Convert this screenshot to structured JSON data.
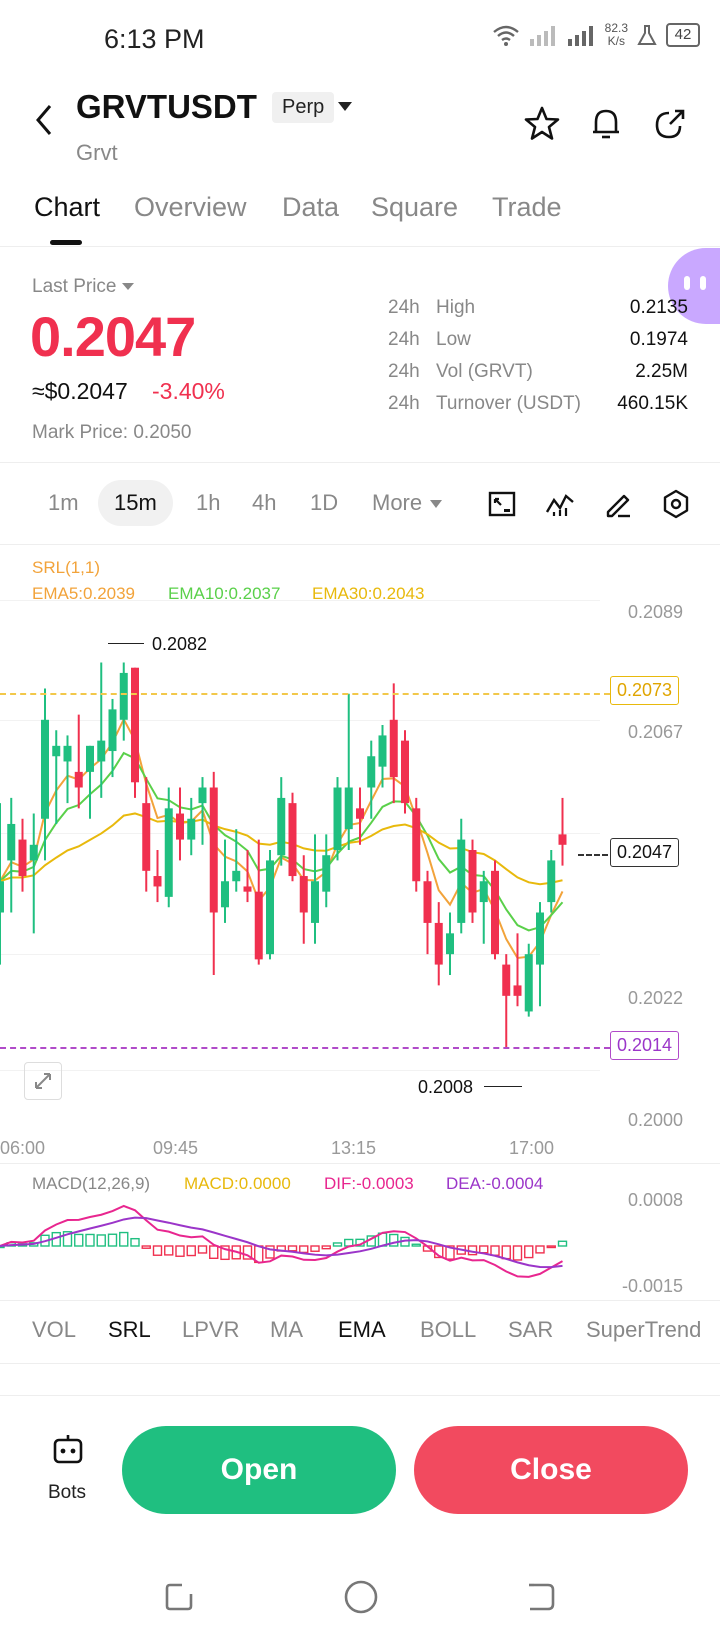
{
  "status": {
    "time": "6:13 PM",
    "net_speed_top": "82.3",
    "net_speed_bottom": "K/s",
    "battery": "42"
  },
  "header": {
    "symbol": "GRVTUSDT",
    "badge": "Perp",
    "name": "Grvt"
  },
  "tabs": [
    "Chart",
    "Overview",
    "Data",
    "Square",
    "Trade"
  ],
  "price": {
    "label": "Last Price",
    "last": "0.2047",
    "usd": "≈$0.2047",
    "change": "-3.40%",
    "mark": "Mark Price: 0.2050",
    "colors": {
      "down": "#f0304f",
      "up": "#1fbf80"
    }
  },
  "stats": [
    {
      "period": "24h",
      "label": "High",
      "value": "0.2135"
    },
    {
      "period": "24h",
      "label": "Low",
      "value": "0.1974"
    },
    {
      "period": "24h",
      "label": "Vol (GRVT)",
      "value": "2.25M"
    },
    {
      "period": "24h",
      "label": "Turnover (USDT)",
      "value": "460.15K"
    }
  ],
  "intervals": {
    "items": [
      "1m",
      "15m",
      "1h",
      "4h",
      "1D"
    ],
    "more": "More",
    "active": "15m"
  },
  "chart": {
    "srl": "SRL(1,1)",
    "ema5": "EMA5:0.2039",
    "ema10": "EMA10:0.2037",
    "ema30": "EMA30:0.2043",
    "y_labels": [
      "0.2089",
      "0.2067",
      "0.2022",
      "0.2000"
    ],
    "tag_top": "0.2073",
    "tag_current": "0.2047",
    "tag_bottom": "0.2014",
    "hi_label": "0.2082",
    "lo_label": "0.2008",
    "x_labels": [
      "06:00",
      "09:45",
      "13:15",
      "17:00"
    ],
    "macd_title": "MACD(12,26,9)",
    "macd_val": "MACD:0.0000",
    "dif": "DIF:-0.0003",
    "dea": "DEA:-0.0004",
    "macd_top": "0.0008",
    "macd_bottom": "-0.0015",
    "colors": {
      "ema5": "#f2a33a",
      "ema10": "#5ad04a",
      "ema30": "#e8b90c",
      "dif": "#e8268f",
      "dea": "#9b35c9"
    }
  },
  "chart_data": {
    "type": "candlestick",
    "interval": "15m",
    "x_ticks": [
      "06:00",
      "09:45",
      "13:15",
      "17:00"
    ],
    "ylim": [
      0.1998,
      0.2094
    ],
    "candles": [
      {
        "o": 0.2034,
        "h": 0.2055,
        "l": 0.2024,
        "c": 0.204
      },
      {
        "o": 0.2044,
        "h": 0.2056,
        "l": 0.2034,
        "c": 0.2051
      },
      {
        "o": 0.2048,
        "h": 0.2052,
        "l": 0.2038,
        "c": 0.2041
      },
      {
        "o": 0.2044,
        "h": 0.2053,
        "l": 0.203,
        "c": 0.2047
      },
      {
        "o": 0.2052,
        "h": 0.2077,
        "l": 0.2044,
        "c": 0.2071
      },
      {
        "o": 0.2064,
        "h": 0.2069,
        "l": 0.2051,
        "c": 0.2066
      },
      {
        "o": 0.2063,
        "h": 0.2068,
        "l": 0.2055,
        "c": 0.2066
      },
      {
        "o": 0.2061,
        "h": 0.2072,
        "l": 0.2054,
        "c": 0.2058
      },
      {
        "o": 0.2061,
        "h": 0.2066,
        "l": 0.2052,
        "c": 0.2066
      },
      {
        "o": 0.2063,
        "h": 0.2082,
        "l": 0.2056,
        "c": 0.2067
      },
      {
        "o": 0.2065,
        "h": 0.2075,
        "l": 0.206,
        "c": 0.2073
      },
      {
        "o": 0.2071,
        "h": 0.2082,
        "l": 0.2067,
        "c": 0.208
      },
      {
        "o": 0.2081,
        "h": 0.2081,
        "l": 0.2056,
        "c": 0.2059
      },
      {
        "o": 0.2055,
        "h": 0.206,
        "l": 0.2038,
        "c": 0.2042
      },
      {
        "o": 0.2041,
        "h": 0.2046,
        "l": 0.2036,
        "c": 0.2039
      },
      {
        "o": 0.2037,
        "h": 0.2058,
        "l": 0.2035,
        "c": 0.2054
      },
      {
        "o": 0.2053,
        "h": 0.2058,
        "l": 0.2044,
        "c": 0.2048
      },
      {
        "o": 0.2048,
        "h": 0.2056,
        "l": 0.2045,
        "c": 0.2052
      },
      {
        "o": 0.2055,
        "h": 0.206,
        "l": 0.2047,
        "c": 0.2058
      },
      {
        "o": 0.2058,
        "h": 0.2061,
        "l": 0.2022,
        "c": 0.2034
      },
      {
        "o": 0.2035,
        "h": 0.2048,
        "l": 0.2032,
        "c": 0.204
      },
      {
        "o": 0.204,
        "h": 0.205,
        "l": 0.2038,
        "c": 0.2042
      },
      {
        "o": 0.2039,
        "h": 0.2046,
        "l": 0.2036,
        "c": 0.2038
      },
      {
        "o": 0.2038,
        "h": 0.2048,
        "l": 0.2024,
        "c": 0.2025
      },
      {
        "o": 0.2026,
        "h": 0.2046,
        "l": 0.2025,
        "c": 0.2044
      },
      {
        "o": 0.2045,
        "h": 0.206,
        "l": 0.2043,
        "c": 0.2056
      },
      {
        "o": 0.2055,
        "h": 0.2057,
        "l": 0.204,
        "c": 0.2041
      },
      {
        "o": 0.2041,
        "h": 0.2045,
        "l": 0.2028,
        "c": 0.2034
      },
      {
        "o": 0.2032,
        "h": 0.2049,
        "l": 0.2028,
        "c": 0.204
      },
      {
        "o": 0.2038,
        "h": 0.2049,
        "l": 0.2035,
        "c": 0.2045
      },
      {
        "o": 0.2046,
        "h": 0.206,
        "l": 0.2044,
        "c": 0.2058
      },
      {
        "o": 0.205,
        "h": 0.2076,
        "l": 0.2046,
        "c": 0.2058
      },
      {
        "o": 0.2054,
        "h": 0.2058,
        "l": 0.2047,
        "c": 0.2052
      },
      {
        "o": 0.2058,
        "h": 0.2067,
        "l": 0.2052,
        "c": 0.2064
      },
      {
        "o": 0.2062,
        "h": 0.207,
        "l": 0.2058,
        "c": 0.2068
      },
      {
        "o": 0.2071,
        "h": 0.2078,
        "l": 0.2055,
        "c": 0.206
      },
      {
        "o": 0.2067,
        "h": 0.2069,
        "l": 0.2053,
        "c": 0.2055
      },
      {
        "o": 0.2054,
        "h": 0.2056,
        "l": 0.2038,
        "c": 0.204
      },
      {
        "o": 0.204,
        "h": 0.2042,
        "l": 0.2026,
        "c": 0.2032
      },
      {
        "o": 0.2032,
        "h": 0.2036,
        "l": 0.202,
        "c": 0.2024
      },
      {
        "o": 0.2026,
        "h": 0.2034,
        "l": 0.2022,
        "c": 0.203
      },
      {
        "o": 0.2032,
        "h": 0.2052,
        "l": 0.203,
        "c": 0.2048
      },
      {
        "o": 0.2046,
        "h": 0.2048,
        "l": 0.2032,
        "c": 0.2034
      },
      {
        "o": 0.2036,
        "h": 0.2042,
        "l": 0.2028,
        "c": 0.204
      },
      {
        "o": 0.2042,
        "h": 0.2044,
        "l": 0.2025,
        "c": 0.2026
      },
      {
        "o": 0.2024,
        "h": 0.2026,
        "l": 0.2008,
        "c": 0.2018
      },
      {
        "o": 0.202,
        "h": 0.203,
        "l": 0.2016,
        "c": 0.2018
      },
      {
        "o": 0.2015,
        "h": 0.2028,
        "l": 0.2014,
        "c": 0.2026
      },
      {
        "o": 0.2024,
        "h": 0.2036,
        "l": 0.2016,
        "c": 0.2034
      },
      {
        "o": 0.2036,
        "h": 0.2046,
        "l": 0.2034,
        "c": 0.2044
      },
      {
        "o": 0.2049,
        "h": 0.2056,
        "l": 0.2043,
        "c": 0.2047
      }
    ]
  },
  "indicators": {
    "items": [
      "VOL",
      "SRL",
      "LPVR",
      "MA",
      "EMA",
      "BOLL",
      "SAR",
      "SuperTrend"
    ],
    "selected": [
      "SRL",
      "EMA"
    ]
  },
  "actions": {
    "bots": "Bots",
    "open": "Open",
    "close": "Close"
  }
}
